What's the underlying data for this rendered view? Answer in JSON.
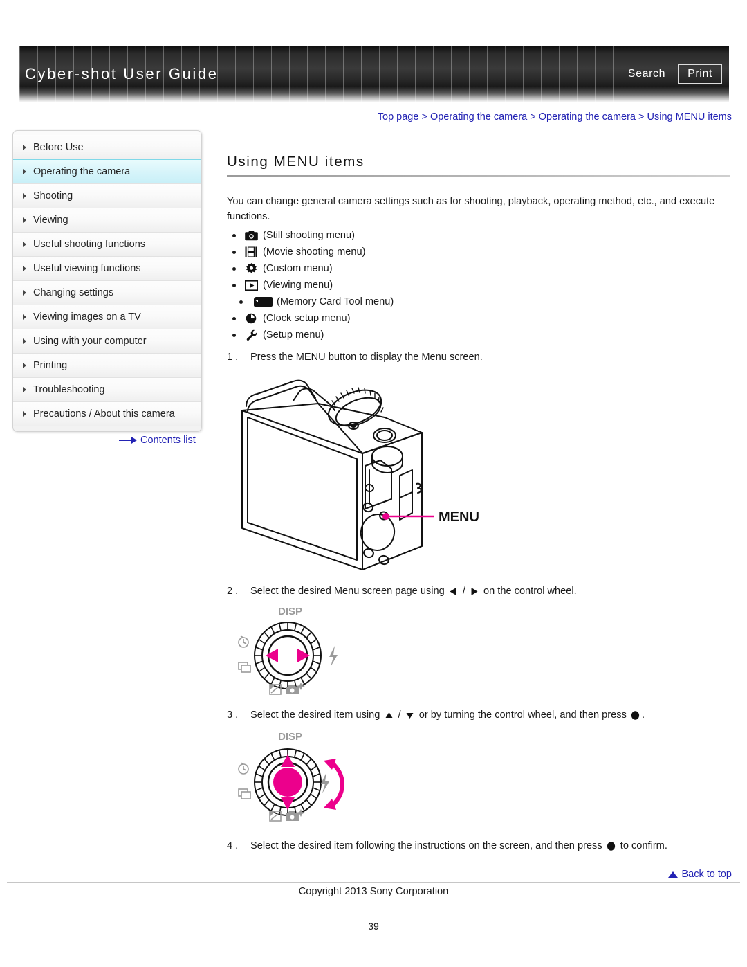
{
  "header": {
    "title": "Cyber-shot User Guide",
    "search_label": "Search",
    "print_label": "Print"
  },
  "breadcrumb": {
    "items": [
      "Top page",
      "Operating the camera",
      "Operating the camera",
      "Using MENU items"
    ],
    "separator": ">"
  },
  "sidebar": {
    "items": [
      {
        "label": "Before Use",
        "active": false
      },
      {
        "label": "Operating the camera",
        "active": true
      },
      {
        "label": "Shooting",
        "active": false
      },
      {
        "label": "Viewing",
        "active": false
      },
      {
        "label": "Useful shooting functions",
        "active": false
      },
      {
        "label": "Useful viewing functions",
        "active": false
      },
      {
        "label": "Changing settings",
        "active": false
      },
      {
        "label": "Viewing images on a TV",
        "active": false
      },
      {
        "label": "Using with your computer",
        "active": false
      },
      {
        "label": "Printing",
        "active": false
      },
      {
        "label": "Troubleshooting",
        "active": false
      },
      {
        "label": "Precautions / About this camera",
        "active": false
      }
    ],
    "contents_list_label": "Contents list"
  },
  "main": {
    "title": "Using MENU items",
    "intro": "You can change general camera settings such as for shooting, playback, operating method, etc., and execute functions.",
    "menu_items": [
      {
        "icon": "still-camera-icon",
        "label": "(Still shooting menu)"
      },
      {
        "icon": "movie-film-icon",
        "label": "(Movie shooting menu)"
      },
      {
        "icon": "gear-icon",
        "label": "(Custom menu)"
      },
      {
        "icon": "play-box-icon",
        "label": "(Viewing menu)"
      },
      {
        "icon": "memory-card-icon",
        "label": "(Memory Card Tool menu)"
      },
      {
        "icon": "clock-icon",
        "label": "(Clock setup menu)"
      },
      {
        "icon": "wrench-icon",
        "label": "(Setup menu)"
      }
    ],
    "steps": [
      {
        "num": "1 .",
        "text_before": "Press the MENU button to display the Menu screen.",
        "text_mid": "",
        "text_after": ""
      },
      {
        "num": "2 .",
        "text_before": "Select the desired Menu screen page using",
        "text_mid": "/",
        "text_after": "on the control wheel."
      },
      {
        "num": "3 .",
        "text_before": "Select the desired item using",
        "text_mid": "/",
        "text_after": "or by turning the control wheel, and then press",
        "text_end": "."
      },
      {
        "num": "4 .",
        "text_before": "Select the desired item following the instructions on the screen, and then press",
        "text_after": "to confirm."
      }
    ],
    "camera_figure": {
      "callout_label": "MENU",
      "callout_color": "#ec008c"
    },
    "wheel_figure": {
      "disp_label": "DISP",
      "highlight_color": "#ec008c"
    }
  },
  "footer": {
    "back_to_top": "Back to top",
    "copyright": "Copyright 2013 Sony Corporation",
    "page_number": "39"
  }
}
